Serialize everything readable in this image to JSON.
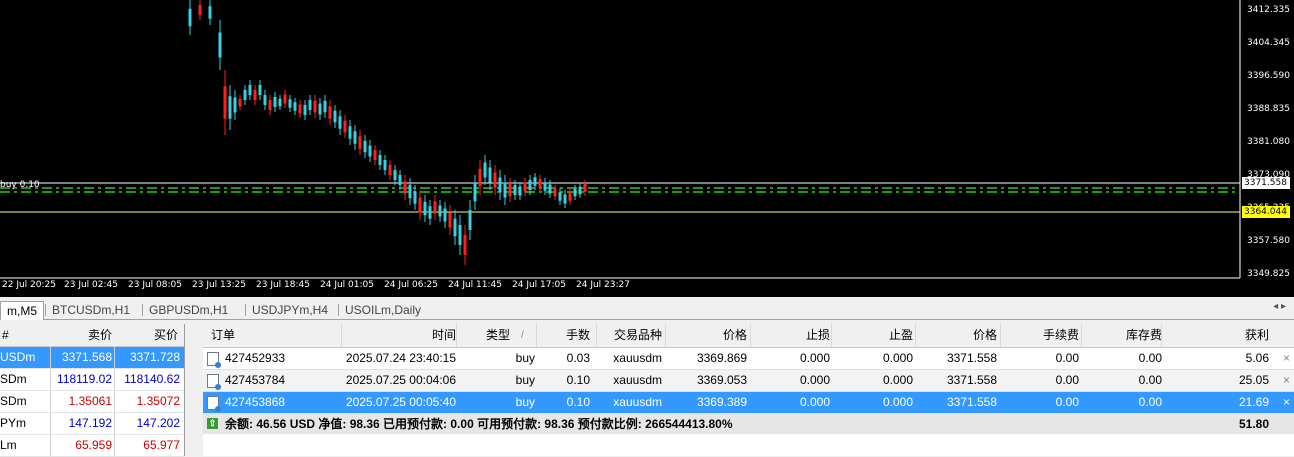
{
  "chart": {
    "price_labels": [
      "3412.335",
      "3404.345",
      "3396.590",
      "3388.835",
      "3381.080",
      "3373.090",
      "3365.335",
      "3357.580",
      "3349.825"
    ],
    "time_labels": [
      "22 Jul 20:25",
      "23 Jul 02:45",
      "23 Jul 08:05",
      "23 Jul 13:25",
      "23 Jul 18:45",
      "24 Jul 01:05",
      "24 Jul 06:25",
      "24 Jul 11:45",
      "24 Jul 17:05",
      "24 Jul 23:27"
    ],
    "bid_price": "3371.558",
    "order_price": "3364.044",
    "order_line_label": "buy 0.10",
    "colors": {
      "bull": "#39d0e0",
      "bear": "#ff2020",
      "order_line": "#22cc22",
      "hline": "#ffffff",
      "order_tag": "#ffff00"
    }
  },
  "tabs": [
    {
      "label": "m,M5",
      "active": true
    },
    {
      "label": "BTCUSDm,H1",
      "active": false
    },
    {
      "label": "GBPUSDm,H1",
      "active": false
    },
    {
      "label": "USDJPYm,H4",
      "active": false
    },
    {
      "label": "USOILm,Daily",
      "active": false
    }
  ],
  "tab_arrows": "◂ ▸",
  "market_watch": {
    "headers": {
      "symbol": "#",
      "bid": "卖价",
      "ask": "买价"
    },
    "rows": [
      {
        "symbol": "USDm",
        "bid": "3371.568",
        "ask": "3371.728",
        "sel": true,
        "color": "#ffffff"
      },
      {
        "symbol": "SDm",
        "bid": "118119.02",
        "ask": "118140.62",
        "sel": false,
        "color": "#0000cc"
      },
      {
        "symbol": "SDm",
        "bid": "1.35061",
        "ask": "1.35072",
        "sel": false,
        "color": "#cc0000"
      },
      {
        "symbol": "PYm",
        "bid": "147.192",
        "ask": "147.202",
        "sel": false,
        "color": "#0000cc"
      },
      {
        "symbol": "Lm",
        "bid": "65.959",
        "ask": "65.977",
        "sel": false,
        "color": "#cc0000"
      }
    ]
  },
  "trade": {
    "headers": {
      "order": "订单",
      "time": "时间",
      "type": "类型",
      "type_sort": "/",
      "volume": "手数",
      "symbol": "交易品种",
      "price": "价格",
      "sl": "止损",
      "tp": "止盈",
      "price2": "价格",
      "commission": "手续费",
      "swap": "库存费",
      "profit": "获利"
    },
    "rows": [
      {
        "order": "427452933",
        "time": "2025.07.24 23:40:15",
        "type": "buy",
        "volume": "0.03",
        "symbol": "xauusdm",
        "price": "3369.869",
        "sl": "0.000",
        "tp": "0.000",
        "price2": "3371.558",
        "commission": "0.00",
        "swap": "0.00",
        "profit": "5.06"
      },
      {
        "order": "427453784",
        "time": "2025.07.25 00:04:06",
        "type": "buy",
        "volume": "0.10",
        "symbol": "xauusdm",
        "price": "3369.053",
        "sl": "0.000",
        "tp": "0.000",
        "price2": "3371.558",
        "commission": "0.00",
        "swap": "0.00",
        "profit": "25.05"
      },
      {
        "order": "427453868",
        "time": "2025.07.25 00:05:40",
        "type": "buy",
        "volume": "0.10",
        "symbol": "xauusdm",
        "price": "3369.389",
        "sl": "0.000",
        "tp": "0.000",
        "price2": "3371.558",
        "commission": "0.00",
        "swap": "0.00",
        "profit": "21.69"
      }
    ],
    "summary": {
      "text": "余额: 46.56 USD  净值: 98.36  已用预付款: 0.00  可用预付款: 98.36  预付款比例: 266544413.80%",
      "total": "51.80"
    },
    "close_glyph": "×",
    "summary_icon": "⇧"
  }
}
